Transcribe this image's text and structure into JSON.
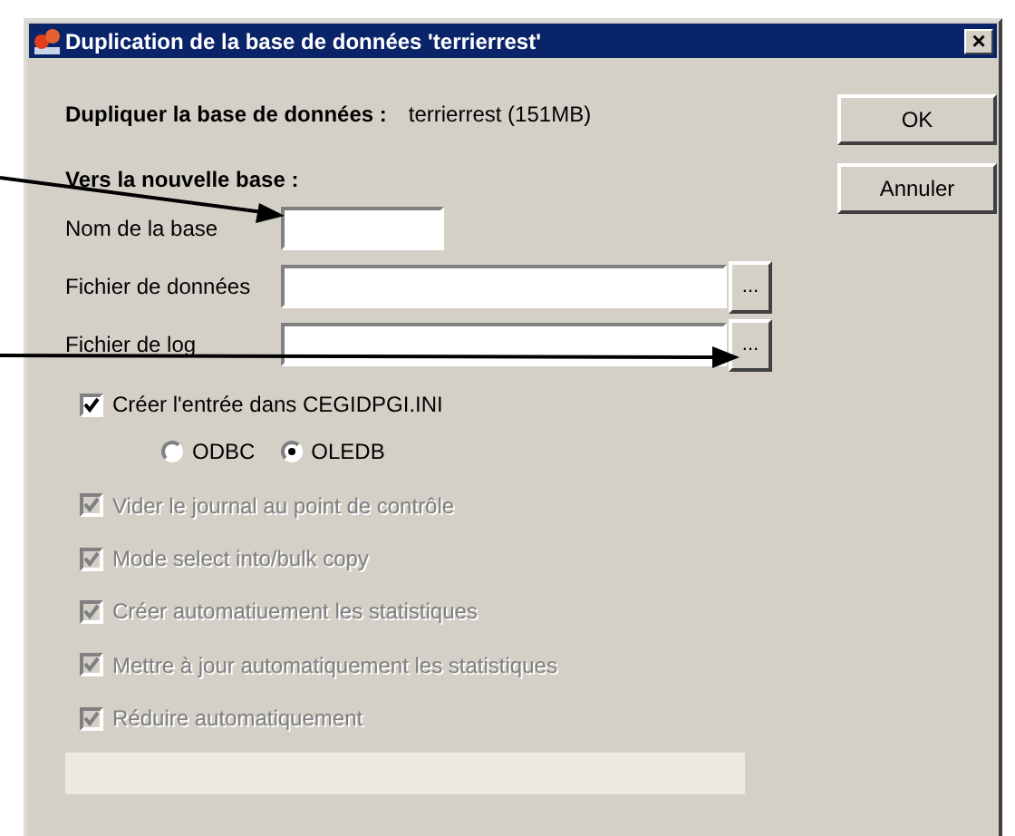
{
  "window": {
    "title": "Duplication de la base de données 'terrierrest'",
    "close": "×"
  },
  "source": {
    "label": "Dupliquer la base de données :",
    "value": "terrierrest (151MB)"
  },
  "section": "Vers la nouvelle base :",
  "fields": [
    {
      "label": "Nom de la base",
      "kind": "short"
    },
    {
      "label": "Fichier de données",
      "kind": "path",
      "browse": "..."
    },
    {
      "label": "Fichier de log",
      "kind": "path",
      "browse": "..."
    }
  ],
  "create_entry": {
    "label": "Créer l'entrée dans CEGIDPGI.INI",
    "checked": true
  },
  "providers": [
    {
      "label": "ODBC",
      "selected": false
    },
    {
      "label": "OLEDB",
      "selected": true
    }
  ],
  "options": [
    {
      "label": "Vider le journal au point de contrôle",
      "checked": true,
      "disabled": true
    },
    {
      "label": "Mode select into/bulk copy",
      "checked": true,
      "disabled": true
    },
    {
      "label": "Créer automatiuement les statistiques",
      "checked": true,
      "disabled": true
    },
    {
      "label": "Mettre à jour automatiquement les statistiques",
      "checked": true,
      "disabled": true
    },
    {
      "label": "Réduire automatiquement",
      "checked": true,
      "disabled": true
    }
  ],
  "buttons": [
    "OK",
    "Annuler"
  ]
}
